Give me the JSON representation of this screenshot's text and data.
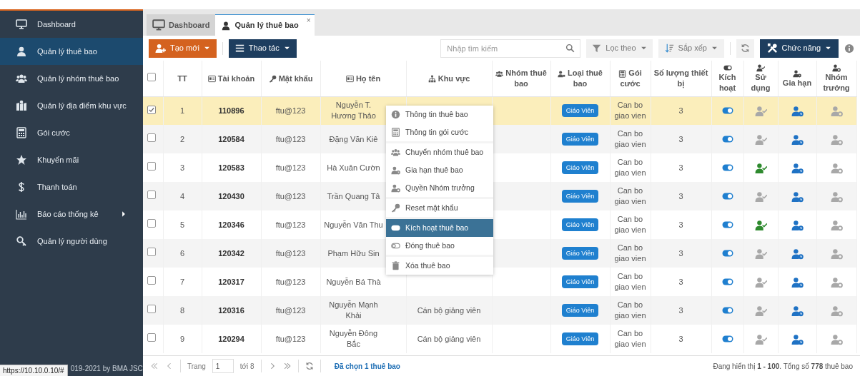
{
  "sidebar": {
    "items": [
      {
        "label": "Dashboard",
        "selected": false
      },
      {
        "label": "Quản lý thuê bao",
        "selected": true
      },
      {
        "label": "Quản lý nhóm thuê bao",
        "selected": false
      },
      {
        "label": "Quản lý địa điểm khu vực",
        "selected": false
      },
      {
        "label": "Gói cước",
        "selected": false
      },
      {
        "label": "Khuyến mãi",
        "selected": false
      },
      {
        "label": "Thanh toán",
        "selected": false
      },
      {
        "label": "Báo cáo thống kê",
        "selected": false,
        "submenu": true
      },
      {
        "label": "Quản lý người dùng",
        "selected": false
      }
    ],
    "copyright": "019-2021 by BMA JSC"
  },
  "status_url": "https://10.10.0.10/#",
  "tabs": [
    {
      "label": "Dashboard",
      "selected": false
    },
    {
      "label": "Quản lý thuê bao",
      "selected": true,
      "close": "×"
    }
  ],
  "toolbar": {
    "create": "Tạo mới",
    "actions": "Thao tác",
    "search": {
      "placeholder": "Nhập tìm kiếm"
    },
    "filter": "Lọc theo",
    "sort": "Sắp xếp",
    "functions": "Chức năng"
  },
  "table": {
    "columns": [
      {
        "kind": "check",
        "checked": false
      },
      {
        "kind": "text",
        "label": "TT"
      },
      {
        "kind": "text",
        "label": "Tài khoản"
      },
      {
        "kind": "text",
        "label": "Mật khẩu"
      },
      {
        "kind": "text",
        "label": "Họ tên"
      },
      {
        "kind": "text",
        "label": "Khu vực"
      },
      {
        "kind": "text",
        "label": "Nhóm thuê bao"
      },
      {
        "kind": "text",
        "label": "Loại thuê bao"
      },
      {
        "kind": "text",
        "label": "Gói cước"
      },
      {
        "kind": "text",
        "label": "Số lượng thiết bị"
      },
      {
        "kind": "stack",
        "label": "Kích hoạt"
      },
      {
        "kind": "stack",
        "label": "Sử dụng"
      },
      {
        "kind": "stack",
        "label": "Gia hạn"
      },
      {
        "kind": "stack",
        "label": "Nhóm trưởng"
      }
    ],
    "rows": [
      {
        "checked": true,
        "selected": true,
        "tt": "1",
        "account": "110896",
        "password": "ftu@123",
        "name": "Nguyễn T. Hương Thảo",
        "type": "Giáo Viên",
        "plan": "Can bo giao vien",
        "devices": "3",
        "active": true,
        "in_use": false,
        "renew": true,
        "leader": false
      },
      {
        "checked": false,
        "selected": false,
        "tt": "2",
        "account": "120584",
        "password": "ftu@123",
        "name": "Đặng Văn Kiê",
        "type": "Giáo Viên",
        "plan": "Can bo giao vien",
        "devices": "3",
        "active": true,
        "in_use": false,
        "renew": true,
        "leader": false
      },
      {
        "checked": false,
        "selected": false,
        "tt": "3",
        "account": "120583",
        "password": "ftu@123",
        "name": "Hà Xuân Cườn",
        "type": "Giáo Viên",
        "plan": "Can bo giao vien",
        "devices": "3",
        "active": true,
        "in_use": true,
        "renew": true,
        "leader": false
      },
      {
        "checked": false,
        "selected": false,
        "tt": "4",
        "account": "120430",
        "password": "ftu@123",
        "name": "Trần Quang Tâ",
        "type": "Giáo Viên",
        "plan": "Can bo giao vien",
        "devices": "3",
        "active": true,
        "in_use": false,
        "renew": true,
        "leader": false
      },
      {
        "checked": false,
        "selected": false,
        "tt": "5",
        "account": "120346",
        "password": "ftu@123",
        "name": "Nguyễn Văn Thu",
        "type": "Giáo Viên",
        "plan": "Can bo giao vien",
        "devices": "3",
        "active": true,
        "in_use": true,
        "renew": true,
        "leader": false
      },
      {
        "checked": false,
        "selected": false,
        "tt": "6",
        "account": "120342",
        "password": "ftu@123",
        "name": "Phạm Hữu Sin",
        "type": "Giáo Viên",
        "plan": "Can bo giao vien",
        "devices": "3",
        "active": true,
        "in_use": false,
        "renew": true,
        "leader": false
      },
      {
        "checked": false,
        "selected": false,
        "tt": "7",
        "account": "120317",
        "password": "ftu@123",
        "name": "Nguyễn Bá Thà",
        "type": "Giáo Viên",
        "plan": "Can bo giao vien",
        "devices": "3",
        "active": true,
        "in_use": false,
        "renew": true,
        "leader": false
      },
      {
        "checked": false,
        "selected": false,
        "tt": "8",
        "account": "120316",
        "password": "ftu@123",
        "name": "Nguyễn Mạnh Khải",
        "area": "Cán bộ giảng viên",
        "type": "Giáo Viên",
        "plan": "Can bo giao vien",
        "devices": "3",
        "active": true,
        "in_use": false,
        "renew": true,
        "leader": false
      },
      {
        "checked": false,
        "selected": false,
        "tt": "9",
        "account": "120294",
        "password": "ftu@123",
        "name": "Nguyễn Đông Bắc",
        "area": "Cán bộ giảng viên",
        "type": "Giáo Viên",
        "plan": "Can bo giao vien",
        "devices": "3",
        "active": true,
        "in_use": false,
        "renew": true,
        "leader": false
      }
    ]
  },
  "context_menu": {
    "groups": [
      [
        {
          "label": "Thông tin thuê bao",
          "selected": false
        },
        {
          "label": "Thông tin gói cước",
          "selected": false
        }
      ],
      [
        {
          "label": "Chuyển nhóm thuê bao",
          "selected": false
        },
        {
          "label": "Gia hạn thuê bao",
          "selected": false
        },
        {
          "label": "Quyền Nhóm trưởng",
          "selected": false
        }
      ],
      [
        {
          "label": "Reset mật khẩu",
          "selected": false
        }
      ],
      [
        {
          "label": "Kích hoạt thuê bao",
          "selected": true
        },
        {
          "label": "Đóng thuê bao",
          "selected": false
        }
      ],
      [
        {
          "label": "Xóa thuê bao",
          "selected": false
        }
      ]
    ]
  },
  "pager": {
    "page_label": "Trang",
    "page": "1",
    "of": "tới 8",
    "selected_info": "Đã chọn 1 thuê bao",
    "summary": "Đang hiển thị **1 - 100**. Tổng số **778** thuê bao"
  }
}
